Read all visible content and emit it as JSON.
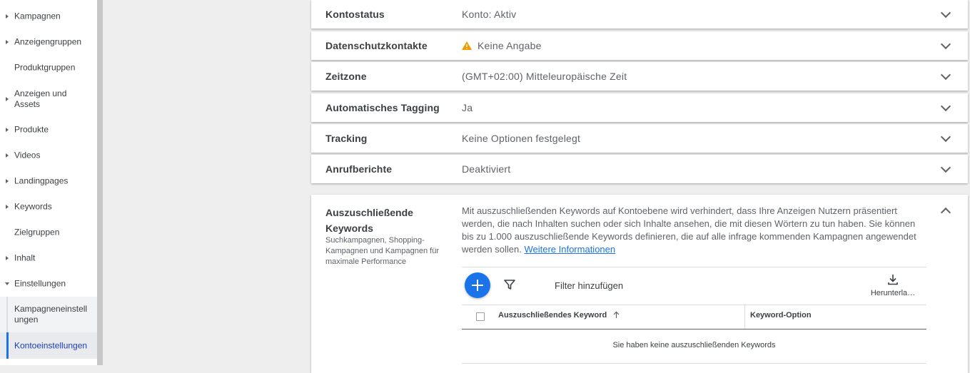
{
  "sidebar": {
    "items": [
      {
        "label": "Kampagnen",
        "arrow": "right"
      },
      {
        "label": "Anzeigengruppen",
        "arrow": "right"
      },
      {
        "label": "Produktgruppen",
        "arrow": "none"
      },
      {
        "label": "Anzeigen und Assets",
        "arrow": "right"
      },
      {
        "label": "Produkte",
        "arrow": "right"
      },
      {
        "label": "Videos",
        "arrow": "right"
      },
      {
        "label": "Landingpages",
        "arrow": "right"
      },
      {
        "label": "Keywords",
        "arrow": "right"
      },
      {
        "label": "Zielgruppen",
        "arrow": "none"
      },
      {
        "label": "Inhalt",
        "arrow": "right"
      },
      {
        "label": "Einstellungen",
        "arrow": "down"
      },
      {
        "label": "Kampagneneinstellungen",
        "arrow": "none"
      },
      {
        "label": "Kontoeinstellungen",
        "arrow": "none",
        "active": true
      }
    ]
  },
  "settings": {
    "rows": [
      {
        "label": "Kontostatus",
        "value": "Konto: Aktiv"
      },
      {
        "label": "Datenschutzkontakte",
        "value": "Keine Angabe",
        "icon": "warning-icon"
      },
      {
        "label": "Zeitzone",
        "value": "(GMT+02:00) Mitteleuropäische Zeit"
      },
      {
        "label": "Automatisches Tagging",
        "value": "Ja"
      },
      {
        "label": "Tracking",
        "value": "Keine Optionen festgelegt"
      },
      {
        "label": "Anrufberichte",
        "value": "Deaktiviert"
      }
    ],
    "negative_keywords": {
      "title": "Auszuschließende Keywords",
      "subtitle": "Suchkampagnen, Shopping-Kampagnen und Kampagnen für maximale Performance",
      "description": "Mit auszuschließenden Keywords auf Kontoebene wird verhindert, dass Ihre Anzeigen Nutzern präsentiert werden, die nach Inhalten suchen oder sich Inhalte ansehen, die mit diesen Wörtern zu tun haben. Sie können bis zu 1.000 auszuschließende Keywords definieren, die auf alle infrage kommenden Kampagnen angewendet werden sollen.",
      "link": "Weitere Informationen",
      "filter_label": "Filter hinzufügen",
      "download_label": "Herunterla…",
      "col_keyword": "Auszuschließendes Keyword",
      "col_option": "Keyword-Option",
      "empty_message": "Sie haben keine auszuschließenden Keywords"
    }
  },
  "colors": {
    "accent": "#1a73e8",
    "warning": "#f29900",
    "active_nav": "#1a3eb0"
  }
}
